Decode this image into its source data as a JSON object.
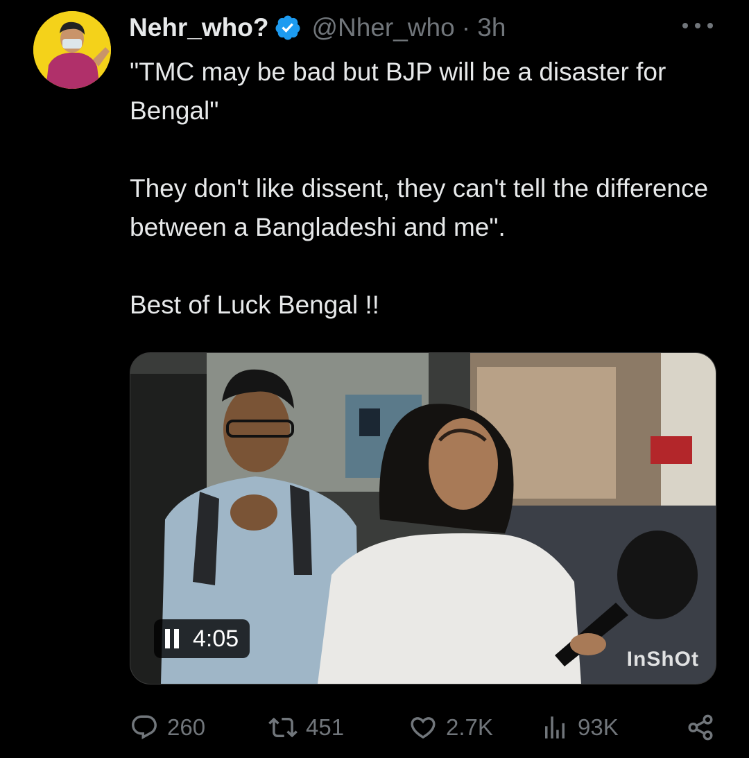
{
  "author": {
    "display_name": "Nehr_who?",
    "handle": "@Nher_who",
    "time": "· 3h",
    "verified": true
  },
  "tweet": {
    "text": "\"TMC may be bad but BJP will be a disaster for Bengal\"\n\nThey don't like dissent, they can't tell the difference between a Bangladeshi and me\".\n\nBest of Luck Bengal !!"
  },
  "media": {
    "duration": "4:05",
    "watermark": "InShOt",
    "state": "paused-icon"
  },
  "actions": {
    "replies": "260",
    "reposts": "451",
    "likes": "2.7K",
    "views": "93K"
  },
  "colors": {
    "background": "#000000",
    "text": "#e7e9ea",
    "secondary_text": "#71767b",
    "verified_badge": "#1d9bf0",
    "avatar_bg": "#f4d21a"
  }
}
